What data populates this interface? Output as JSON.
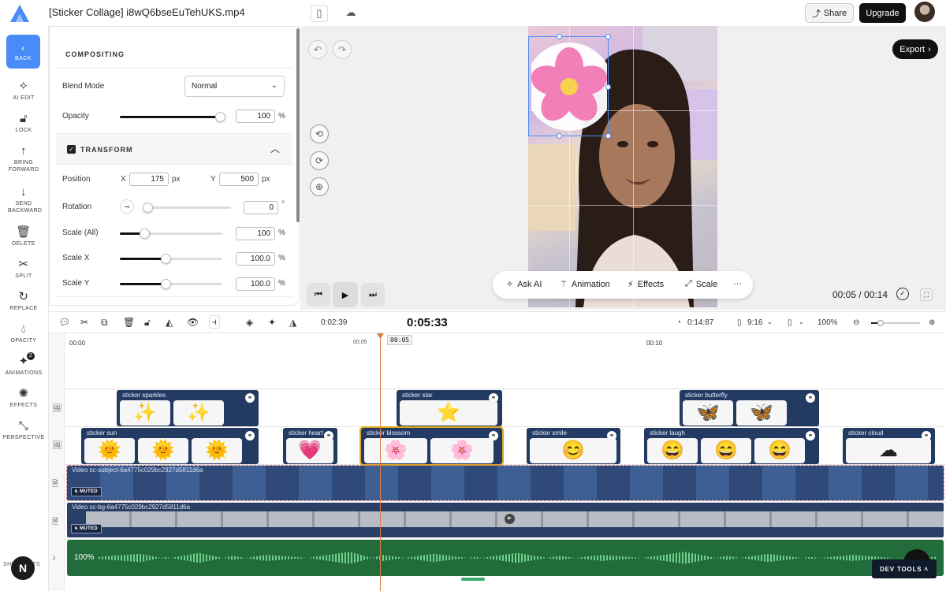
{
  "header": {
    "file_title": "[Sticker Collage] i8wQ6bseEuTehUKS.mp4",
    "share_label": "Share",
    "upgrade_label": "Upgrade"
  },
  "sidebar": {
    "back_label": "BACK",
    "tools": [
      {
        "label": "AI EDIT",
        "icon": "sparkle-icon"
      },
      {
        "label": "LOCK",
        "icon": "lock-icon"
      },
      {
        "label": "BRING FORWARD",
        "icon": "arrow-up-icon"
      },
      {
        "label": "SEND BACKWARD",
        "icon": "arrow-down-icon"
      },
      {
        "label": "DELETE",
        "icon": "trash-icon"
      },
      {
        "label": "SPLIT",
        "icon": "scissors-icon"
      },
      {
        "label": "REPLACE",
        "icon": "refresh-icon"
      },
      {
        "label": "OPACITY",
        "icon": "droplet-icon"
      },
      {
        "label": "ANIMATIONS",
        "icon": "animation-icon",
        "badge": "2"
      },
      {
        "label": "EFFECTS",
        "icon": "effects-icon"
      },
      {
        "label": "PERSPECTIVE",
        "icon": "perspective-icon"
      }
    ],
    "shortcuts_label": "SHORTCUTS",
    "user_initial": "N"
  },
  "panel": {
    "compositing_title": "COMPOSITING",
    "blend_mode_label": "Blend Mode",
    "blend_mode_value": "Normal",
    "opacity_label": "Opacity",
    "opacity_value": "100",
    "opacity_unit": "%",
    "transform_title": "TRANSFORM",
    "position_label": "Position",
    "x_label": "X",
    "x_value": "175",
    "y_label": "Y",
    "y_value": "500",
    "px_unit": "px",
    "rotation_label": "Rotation",
    "rotation_value": "0",
    "rotation_unit": "°",
    "scale_all_label": "Scale (All)",
    "scale_all_value": "100",
    "scale_x_label": "Scale X",
    "scale_x_value": "100.0",
    "scale_y_label": "Scale Y",
    "scale_y_value": "100.0",
    "percent_unit": "%",
    "sliders": {
      "opacity": 1.0,
      "rotation": 0.0,
      "scale_all": 0.24,
      "scale_x": 0.45,
      "scale_y": 0.45
    }
  },
  "preview": {
    "export_label": "Export",
    "floating_bar": {
      "ask_ai": "Ask AI",
      "animation": "Animation",
      "effects": "Effects",
      "scale": "Scale"
    },
    "timecode": "00:05 / 00:14"
  },
  "timeline_toolbar": {
    "position_time": "0:02:39",
    "current_time": "0:05:33",
    "duration": "0:14:87",
    "aspect_ratio": "9:16",
    "zoom": "100%",
    "zoom_level": 0.2
  },
  "timeline": {
    "ruler": [
      "00:00",
      "00:05",
      "00:10"
    ],
    "playhead_tag": "00:05",
    "track1": [
      {
        "label": "sticker sparkles",
        "emoji": "✨"
      },
      {
        "label": "sticker star",
        "emoji": "⭐"
      },
      {
        "label": "sticker butterfly",
        "emoji": "🦋"
      }
    ],
    "track2": [
      {
        "label": "sticker sun",
        "emoji": "🌞"
      },
      {
        "label": "sticker heart",
        "emoji": "💗"
      },
      {
        "label": "sticker blossom",
        "emoji": "🌸"
      },
      {
        "label": "sticker smile",
        "emoji": "😊"
      },
      {
        "label": "sticker laugh",
        "emoji": "😄"
      },
      {
        "label": "sticker cloud",
        "emoji": "☁"
      }
    ],
    "video_subject_label": "Video sc-subject-6a4775c029bc2927d5811d6a",
    "video_bg_label": "Video sc-bg-6a4775c029bc2927d5811d6a",
    "muted_label": "MUTED",
    "audio_volume": "100%"
  },
  "devtools_label": "DEV TOOLS"
}
